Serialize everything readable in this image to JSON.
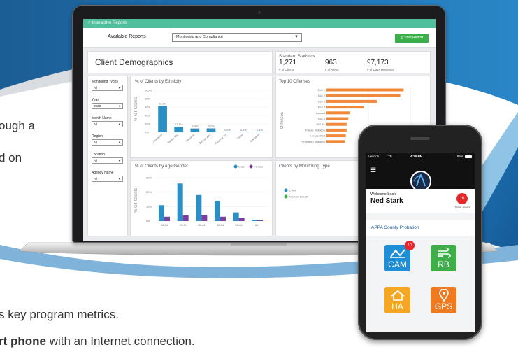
{
  "side_text": {
    "line1": "ough a",
    "line2": "d on",
    "line3": "s key program metrics.",
    "line4_bold": "rt phone",
    "line4_rest": " with an Internet connection."
  },
  "app": {
    "header_title": "Interactive Reports",
    "available_reports_label": "Available Reports",
    "report_select_value": "Monitoring and Compliance",
    "print_button_label": "Print Report"
  },
  "demographics": {
    "title": "Client Demographics"
  },
  "filters": [
    {
      "label": "Monitoring Types",
      "value": "All"
    },
    {
      "label": "Year",
      "value": "2020"
    },
    {
      "label": "Month Name",
      "value": "All"
    },
    {
      "label": "Region",
      "value": "All"
    },
    {
      "label": "Location",
      "value": "All"
    },
    {
      "label": "Agency Name",
      "value": "All"
    }
  ],
  "standard_statistics": {
    "title": "Standard Statistics",
    "items": [
      {
        "value": "1,271",
        "label": "# of Clients"
      },
      {
        "value": "963",
        "label": "# of Alerts"
      },
      {
        "value": "97,173",
        "label": "# of Days Monitored"
      }
    ]
  },
  "chart_data": [
    {
      "type": "bar",
      "title": "% of Clients by Ethnicity",
      "ylabel": "% GT Clients",
      "yticks": [
        "100%",
        "80%",
        "60%",
        "40%",
        "20%",
        "0%"
      ],
      "ylim": [
        0,
        100
      ],
      "categories": [
        "Caucasian",
        "Native Am.",
        "Hispanic",
        "African Am.",
        "Asian or P.I.",
        "Other",
        "Unknown"
      ],
      "values": [
        62.3,
        13.1,
        8.9,
        9.2,
        0.4,
        0.4,
        0.4
      ],
      "data_labels": [
        "62.3%",
        "13.1%",
        "8.9%",
        "9.2%",
        "0.4%",
        "0.4%",
        "0.4%"
      ],
      "color": "#2b8fc4"
    },
    {
      "type": "bar",
      "title": "Top 10 Offenses",
      "ylabel": "Offenses",
      "categories": [
        "DUI 1",
        "DUI 2",
        "DUI 3",
        "DUI 4",
        "Assault",
        "DUI 5",
        "DUI 6+",
        "Parole Violation",
        "Unspecified",
        "Probation Violation"
      ],
      "values": [
        92,
        88,
        60,
        45,
        28,
        26,
        24,
        24,
        23,
        22
      ],
      "color": "#f0893a"
    },
    {
      "type": "bar",
      "title": "% of Clients by Age/Gender",
      "ylabel": "% GT Clients",
      "yticks": [
        "30%",
        "20%",
        "10%",
        "0%"
      ],
      "ylim": [
        0,
        30
      ],
      "categories": [
        "18-24",
        "25-34",
        "35-44",
        "45-54",
        "55-64",
        "65+"
      ],
      "series": [
        {
          "name": "Male",
          "values": [
            11,
            26,
            18,
            14,
            6,
            1
          ],
          "color": "#2b8fc4"
        },
        {
          "name": "Female",
          "values": [
            3,
            4,
            4,
            3,
            2,
            0.5
          ],
          "color": "#7b3fa0"
        }
      ]
    },
    {
      "type": "pie",
      "title": "Clients by Monitoring Type",
      "legend": [
        "CAM",
        "Remote Breath"
      ],
      "colors": [
        "#2b8fc4",
        "#3bb04a"
      ]
    }
  ],
  "phone": {
    "carrier": "Verizon",
    "network": "LTE",
    "time": "4:25 PM",
    "battery": "95%",
    "welcome_label": "Welcome back,",
    "user_name": "Ned Stark",
    "total_alerts_count": "10",
    "total_alerts_label": "Total Alerts",
    "agency": "APPA County Probation",
    "tiles": [
      {
        "label": "CAM",
        "icon": "chart-line-icon",
        "color": "#1e8fd6",
        "badge": "10"
      },
      {
        "label": "RB",
        "icon": "wind-icon",
        "color": "#3fae49"
      },
      {
        "label": "HA",
        "icon": "house-icon",
        "color": "#f5a623"
      },
      {
        "label": "GPS",
        "icon": "location-pin-icon",
        "color": "#f07a20"
      }
    ]
  },
  "colors": {
    "brand_teal": "#4fbf9c",
    "print_green": "#3bb04a",
    "background_blue": "#1e6aa8",
    "bar_blue": "#2b8fc4",
    "bar_orange": "#f0893a",
    "bar_purple": "#7b3fa0"
  }
}
